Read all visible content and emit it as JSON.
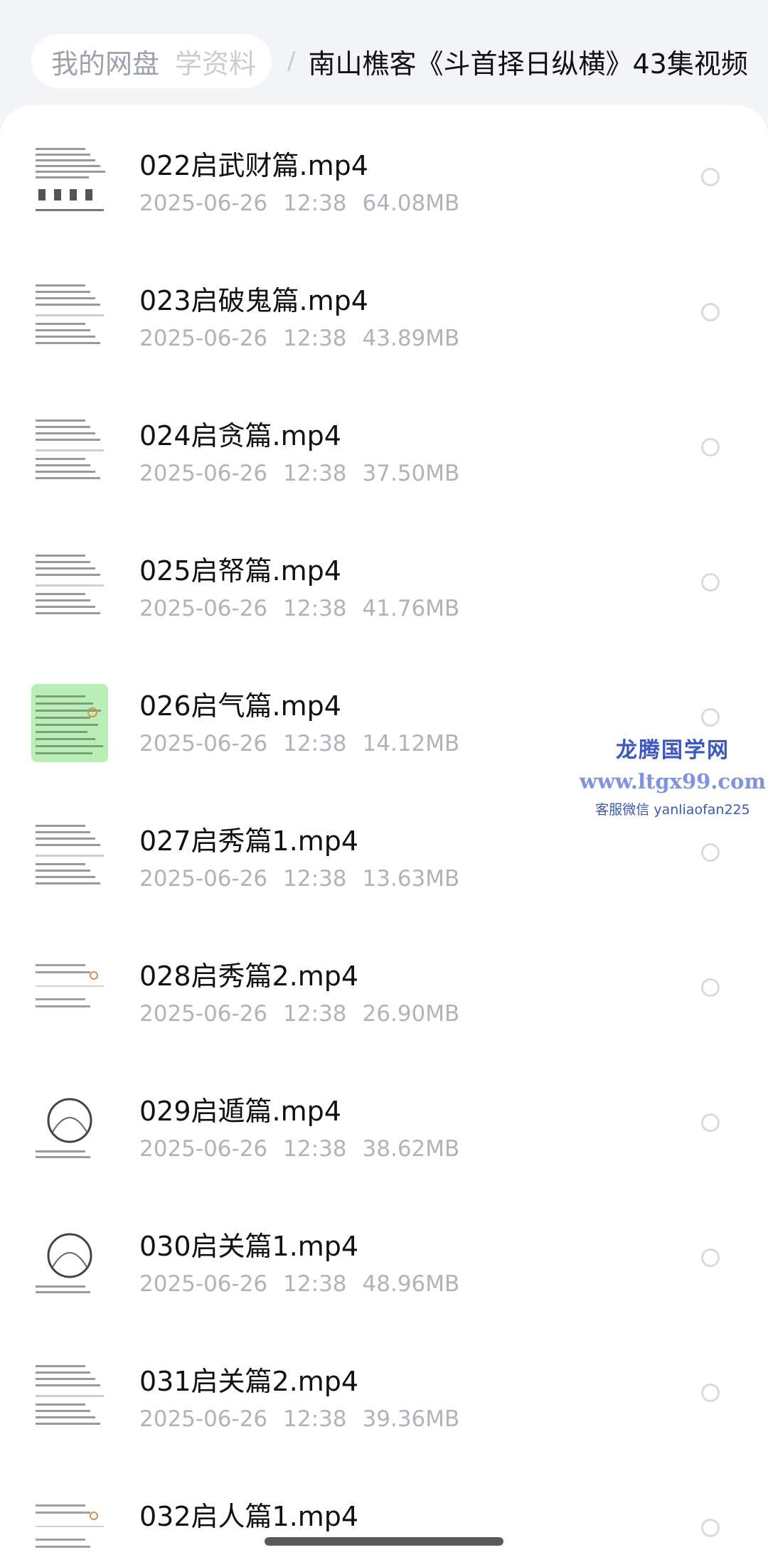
{
  "breadcrumb": {
    "root": "我的网盘",
    "middle": "学资料",
    "separator": "/",
    "current": "南山樵客《斗首择日纵横》43集视频"
  },
  "files": [
    {
      "name": "022启武财篇.mp4",
      "date": "2025-06-26",
      "time": "12:38",
      "size": "64.08MB",
      "thumb": "doc-figures"
    },
    {
      "name": "023启破鬼篇.mp4",
      "date": "2025-06-26",
      "time": "12:38",
      "size": "43.89MB",
      "thumb": "doc-text"
    },
    {
      "name": "024启贪篇.mp4",
      "date": "2025-06-26",
      "time": "12:38",
      "size": "37.50MB",
      "thumb": "doc-text"
    },
    {
      "name": "025启帑篇.mp4",
      "date": "2025-06-26",
      "time": "12:38",
      "size": "41.76MB",
      "thumb": "doc-text"
    },
    {
      "name": "026启气篇.mp4",
      "date": "2025-06-26",
      "time": "12:38",
      "size": "14.12MB",
      "thumb": "doc-green"
    },
    {
      "name": "027启秀篇1.mp4",
      "date": "2025-06-26",
      "time": "12:38",
      "size": "13.63MB",
      "thumb": "doc-text"
    },
    {
      "name": "028启秀篇2.mp4",
      "date": "2025-06-26",
      "time": "12:38",
      "size": "26.90MB",
      "thumb": "doc-sparse"
    },
    {
      "name": "029启遁篇.mp4",
      "date": "2025-06-26",
      "time": "12:38",
      "size": "38.62MB",
      "thumb": "doc-drawing"
    },
    {
      "name": "030启关篇1.mp4",
      "date": "2025-06-26",
      "time": "12:38",
      "size": "48.96MB",
      "thumb": "doc-drawing"
    },
    {
      "name": "031启关篇2.mp4",
      "date": "2025-06-26",
      "time": "12:38",
      "size": "39.36MB",
      "thumb": "doc-text"
    },
    {
      "name": "032启人篇1.mp4",
      "date": "",
      "time": "",
      "size": "",
      "thumb": "doc-sparse"
    }
  ],
  "watermark": {
    "title": "龙腾国学网",
    "url": "www.ltgx99.com",
    "contact": "客服微信 yanliaofan225"
  },
  "colors": {
    "background": "#f3f4f8",
    "panel": "#ffffff",
    "title_text": "#111111",
    "meta_text": "#b0b3bb",
    "watermark": "#3a56c8"
  }
}
